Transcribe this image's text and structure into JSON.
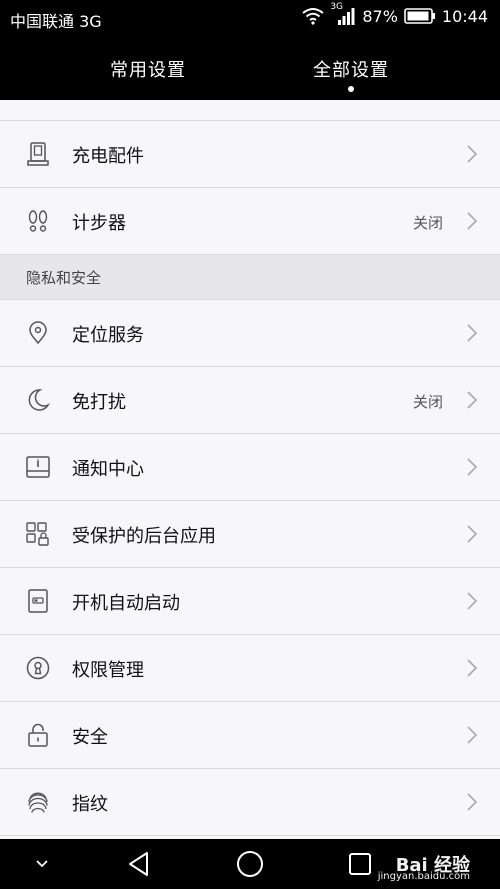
{
  "status_bar": {
    "carrier": "中国联通 3G",
    "network_badge": "3G",
    "battery": "87%",
    "time": "10:44"
  },
  "tabs": [
    {
      "label": "常用设置"
    },
    {
      "label": "全部设置"
    }
  ],
  "rows_top": [
    {
      "label": "充电配件",
      "value": "",
      "icon": "charging-accessory-icon"
    },
    {
      "label": "计步器",
      "value": "关闭",
      "icon": "footprints-icon"
    }
  ],
  "section": {
    "title": "隐私和安全"
  },
  "rows_privacy": [
    {
      "label": "定位服务",
      "value": "",
      "icon": "location-pin-icon"
    },
    {
      "label": "免打扰",
      "value": "关闭",
      "icon": "moon-icon"
    },
    {
      "label": "通知中心",
      "value": "",
      "icon": "notification-center-icon"
    },
    {
      "label": "受保护的后台应用",
      "value": "",
      "icon": "protected-apps-icon"
    },
    {
      "label": "开机自动启动",
      "value": "",
      "icon": "auto-start-icon"
    },
    {
      "label": "权限管理",
      "value": "",
      "icon": "permission-keyhole-icon"
    },
    {
      "label": "安全",
      "value": "",
      "icon": "lock-icon"
    },
    {
      "label": "指纹",
      "value": "",
      "icon": "fingerprint-icon"
    }
  ],
  "watermark": {
    "brand": "Bai 经验",
    "site": "jingyan.baidu.com"
  },
  "colors": {
    "bar": "#000000",
    "background": "#f7f6f8",
    "divider": "#dadada",
    "section": "#e7e6e8"
  }
}
